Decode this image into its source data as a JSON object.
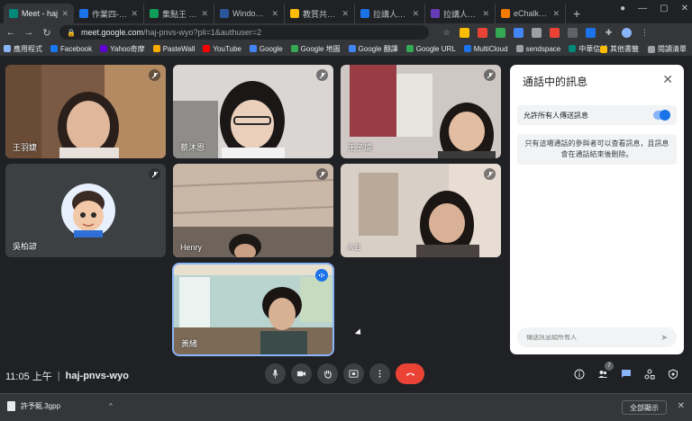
{
  "browser": {
    "tabs": [
      {
        "label": "Meet - haj",
        "color": "#00897b",
        "active": true
      },
      {
        "label": "作業四-全曲刻",
        "color": "#1a73e8"
      },
      {
        "label": "集點王 - Goog",
        "color": "#0f9d58"
      },
      {
        "label": "Windows 10 (",
        "color": "#2b579a"
      },
      {
        "label": "教質共用 - Go",
        "color": "#fbbc04"
      },
      {
        "label": "拉講人室湖做",
        "color": "#1a73e8"
      },
      {
        "label": "拉講人筆刷K和",
        "color": "#673ab7"
      },
      {
        "label": "eChalk: Music",
        "color": "#f57c00"
      }
    ],
    "url_host": "meet.google.com",
    "url_path": "/haj-pnvs-wyo?pli=1&authuser=2",
    "bookmarks": [
      "應用程式",
      "Facebook",
      "Yahoo奇摩",
      "PasteWall",
      "YouTube",
      "Google",
      "Google 地圖",
      "Google 翻譯",
      "Google URL",
      "MultiCloud",
      "sendspace",
      "中華信託"
    ],
    "bookmarks_right": [
      "其他書籤",
      "閱讀清單"
    ]
  },
  "participants": [
    {
      "name": "王羽婕"
    },
    {
      "name": "蔡沐恩"
    },
    {
      "name": "王子瑜"
    },
    {
      "name": "吳柏諺"
    },
    {
      "name": "Henry"
    },
    {
      "name": "A E"
    },
    {
      "name": "黃緒"
    }
  ],
  "chat": {
    "title": "通話中的訊息",
    "allow_label": "允許所有人傳送訊息",
    "allow_enabled": true,
    "notice": "只有這場通話的參與者可以查看訊息，且訊息會在通話結束後刪除。",
    "input_placeholder": "傳送訊息給所有人"
  },
  "meeting": {
    "time": "11:05 上午",
    "separator": "|",
    "code": "haj-pnvs-wyo",
    "participant_count": "7"
  },
  "downloads": {
    "file_name": "許予甄.3gpp",
    "show_all": "全部顯示"
  },
  "colors": {
    "accent": "#1a73e8",
    "end_call": "#ea4335",
    "panel_bg": "#202124"
  }
}
